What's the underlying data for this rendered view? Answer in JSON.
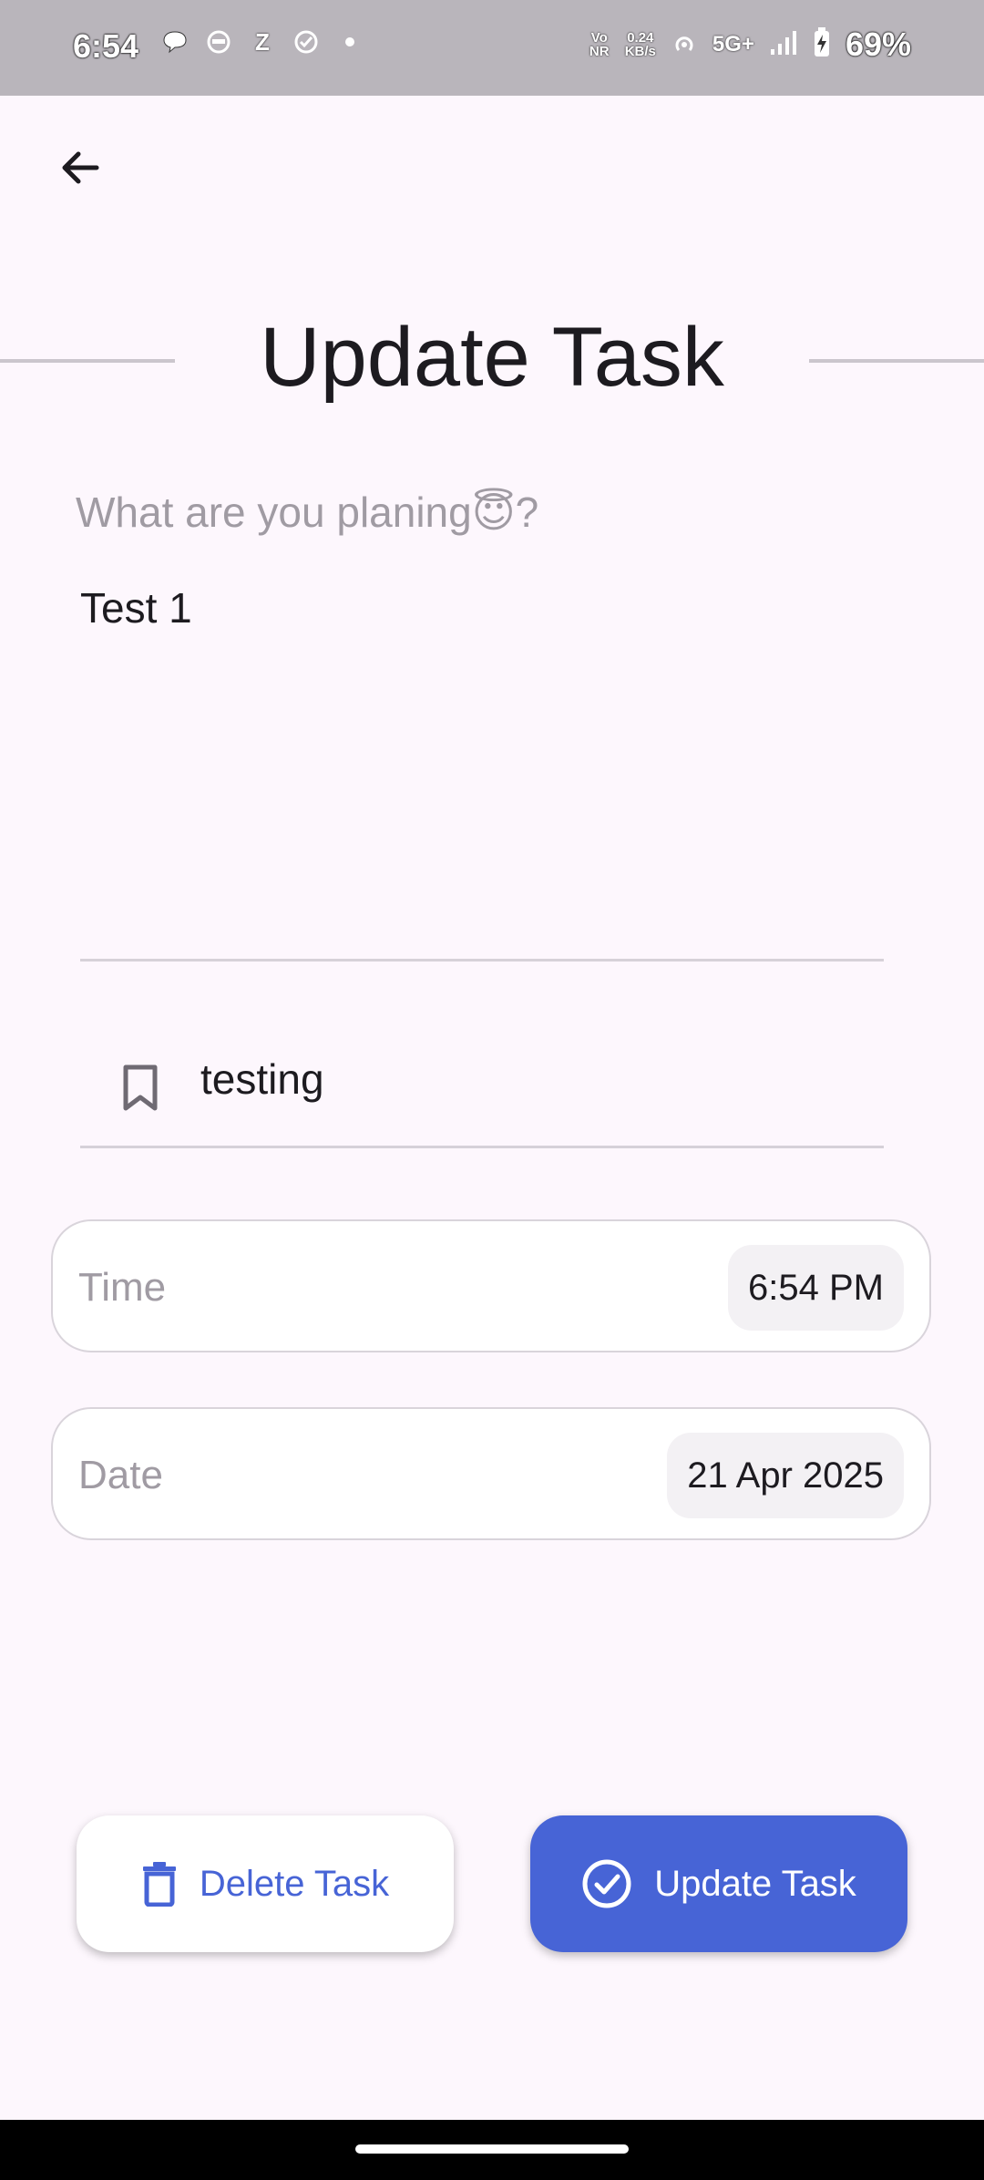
{
  "status_bar": {
    "time": "6:54",
    "network_label": "Vo NR",
    "speed_value": "0.24",
    "speed_unit": "KB/s",
    "network_type": "5G+",
    "battery": "69%",
    "icons": [
      "chat-icon",
      "helmet-icon",
      "z-app-icon",
      "check-circle-icon",
      "dot-icon",
      "hotspot-icon",
      "signal-icon",
      "battery-charging-icon"
    ]
  },
  "header": {
    "back_icon": "arrow-left-icon",
    "title": "Update Task"
  },
  "form": {
    "prompt": "What are you planing😇?",
    "task_value": "Test 1",
    "category_icon": "bookmark-icon",
    "category_value": "testing",
    "time": {
      "label": "Time",
      "value": "6:54 PM"
    },
    "date": {
      "label": "Date",
      "value": "21 Apr 2025"
    }
  },
  "actions": {
    "delete_label": "Delete Task",
    "delete_icon": "trash-icon",
    "update_label": "Update Task",
    "update_icon": "check-circle-icon"
  },
  "colors": {
    "accent": "#4764d6",
    "background": "#fdf7fd",
    "status_bar": "#b9b5bb"
  }
}
